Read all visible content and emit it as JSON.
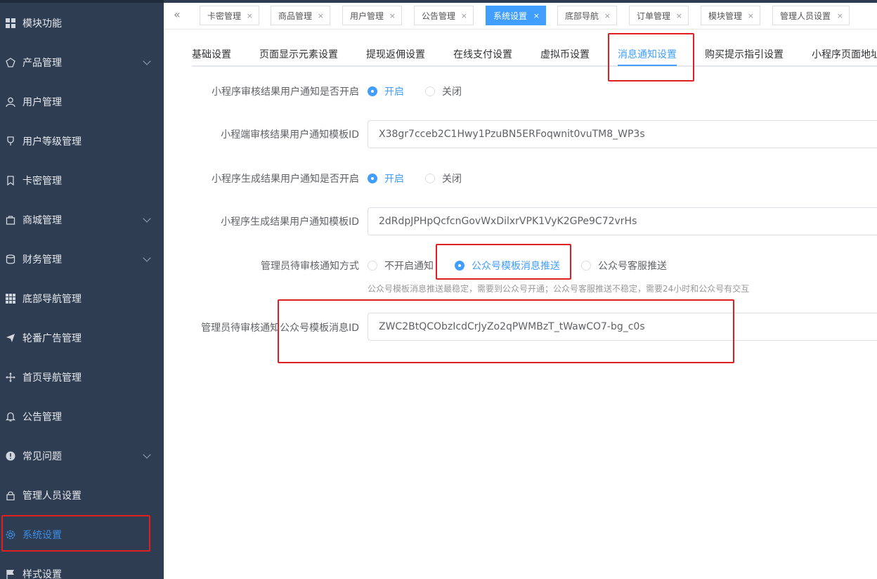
{
  "sidebar": {
    "items": [
      {
        "label": "模块功能",
        "icon": "grid-icon",
        "chevron": false
      },
      {
        "label": "产品管理",
        "icon": "product-icon",
        "chevron": true
      },
      {
        "label": "用户管理",
        "icon": "user-icon",
        "chevron": false
      },
      {
        "label": "用户等级管理",
        "icon": "trophy-icon",
        "chevron": false
      },
      {
        "label": "卡密管理",
        "icon": "bookmark-icon",
        "chevron": false
      },
      {
        "label": "商城管理",
        "icon": "bag-icon",
        "chevron": true
      },
      {
        "label": "财务管理",
        "icon": "database-icon",
        "chevron": true
      },
      {
        "label": "底部导航管理",
        "icon": "grid-icon",
        "chevron": false
      },
      {
        "label": "轮番广告管理",
        "icon": "send-icon",
        "chevron": false
      },
      {
        "label": "首页导航管理",
        "icon": "move-icon",
        "chevron": false
      },
      {
        "label": "公告管理",
        "icon": "bell-icon",
        "chevron": false
      },
      {
        "label": "常见问题",
        "icon": "question-icon",
        "chevron": true
      },
      {
        "label": "管理人员设置",
        "icon": "lock-icon",
        "chevron": false
      },
      {
        "label": "系统设置",
        "icon": "gear-icon",
        "chevron": false,
        "active": true
      },
      {
        "label": "样式设置",
        "icon": "flag-icon",
        "chevron": false
      }
    ]
  },
  "topbar": {
    "collapse_glyph": "«",
    "tabs": [
      {
        "label": "卡密管理"
      },
      {
        "label": "商品管理"
      },
      {
        "label": "用户管理"
      },
      {
        "label": "公告管理"
      },
      {
        "label": "系统设置",
        "active": true
      },
      {
        "label": "底部导航"
      },
      {
        "label": "订单管理"
      },
      {
        "label": "模块管理"
      },
      {
        "label": "管理人员设置"
      }
    ],
    "close_glyph": "×"
  },
  "subtabs": [
    {
      "label": "基础设置"
    },
    {
      "label": "页面显示元素设置"
    },
    {
      "label": "提现返佣设置"
    },
    {
      "label": "在线支付设置"
    },
    {
      "label": "虚拟币设置"
    },
    {
      "label": "消息通知设置",
      "active": true
    },
    {
      "label": "购买提示指引设置"
    },
    {
      "label": "小程序页面地址"
    }
  ],
  "form": {
    "review_notify_label": "小程序审核结果用户通知是否开启",
    "review_notify_on": "开启",
    "review_notify_off": "关闭",
    "review_template_label": "小程端审核结果用户通知模板ID",
    "review_template_value": "X38gr7cceb2C1Hwy1PzuBN5ERFoqwnit0vuTM8_WP3s",
    "generate_notify_label": "小程序生成结果用户通知是否开启",
    "generate_notify_on": "开启",
    "generate_notify_off": "关闭",
    "generate_template_label": "小程序生成结果用户通知模板ID",
    "generate_template_value": "2dRdpJPHpQcfcnGovWxDilxrVPK1VyK2GPe9C72vrHs",
    "admin_method_label": "管理员待审核通知方式",
    "admin_method_opt1": "不开启通知",
    "admin_method_opt2": "公众号模板消息推送",
    "admin_method_opt3": "公众号客服推送",
    "admin_method_hint": "公众号模板消息推送最稳定，需要到公众号开通；公众号客服推送不稳定，需要24小时和公众号有交互",
    "admin_template_label": "管理员待审核通知公众号模板消息ID",
    "admin_template_value": "ZWC2BtQCObzIcdCrJyZo2qPWMBzT_tWawCO7-bg_c0s"
  },
  "colors": {
    "sidebar_bg": "#2f3d52",
    "accent": "#409eff",
    "highlight": "#e02020"
  }
}
